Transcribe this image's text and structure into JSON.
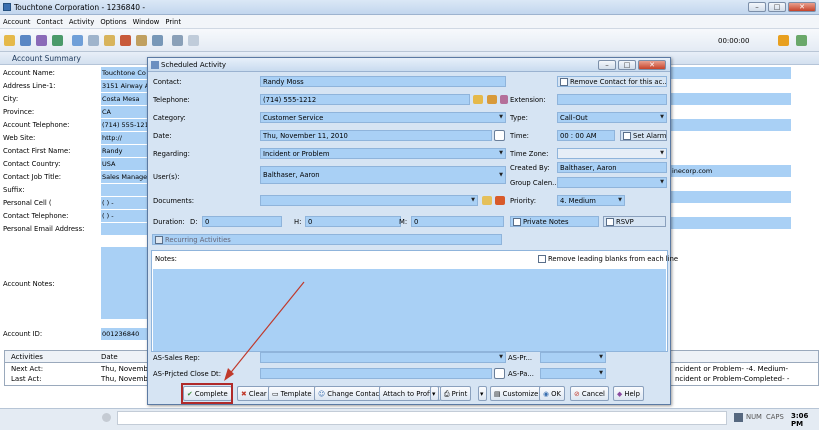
{
  "window": {
    "title": "Touchtone Corporation - 1236840 -"
  },
  "menu": [
    "Account",
    "Contact",
    "Activity",
    "Options",
    "Window",
    "Print"
  ],
  "toolbar": {
    "timer": "00:00:00"
  },
  "account_summary": {
    "title": "Account Summary",
    "rows": [
      {
        "label": "Account Name:",
        "value": "Touchtone Co"
      },
      {
        "label": "Address Line-1:",
        "value": "3151 Airway A"
      },
      {
        "label": "City:",
        "value": "Costa Mesa"
      },
      {
        "label": "Province:",
        "value": "CA"
      },
      {
        "label": "Account Telephone:",
        "value": "(714) 555-121"
      },
      {
        "label": "Web Site:",
        "value": "http://"
      },
      {
        "label": "Contact First Name:",
        "value": "Randy"
      },
      {
        "label": "Contact Country:",
        "value": "USA"
      },
      {
        "label": "Contact Job Title:",
        "value": "Sales Manage"
      },
      {
        "label": "Suffix:",
        "value": ""
      },
      {
        "label": "Personal Cell (",
        "value": "(   )   -"
      },
      {
        "label": "Contact Telephone:",
        "value": "(   )   -"
      },
      {
        "label": "Personal Email Address:",
        "value": ""
      }
    ],
    "notes_label": "Account Notes:",
    "id_label": "Account ID:",
    "id_value": "001236840",
    "right_email": "inecorp.com"
  },
  "grid": {
    "headers": [
      "Activities",
      "Date"
    ],
    "rows": [
      [
        "Next Act:",
        "Thu, November"
      ],
      [
        "Last Act:",
        "Thu, November"
      ]
    ],
    "right_rows": [
      "ncident or Problem- -4. Medium-",
      "ncident or Problem-Completed- -"
    ]
  },
  "dialog": {
    "title": "Scheduled Activity",
    "contact_label": "Contact:",
    "contact": "Randy Moss",
    "remove_contact": "Remove Contact for this ac...",
    "telephone_label": "Telephone:",
    "telephone": "(714) 555-1212",
    "extension_label": "Extension:",
    "category_label": "Category:",
    "category": "Customer Service",
    "type_label": "Type:",
    "type": "Call-Out",
    "date_label": "Date:",
    "date": "Thu, November 11, 2010",
    "time_label": "Time:",
    "time": "00 : 00   AM",
    "set_alarm": "Set Alarm",
    "regarding_label": "Regarding:",
    "regarding": "Incident or Problem",
    "timezone_label": "Time Zone:",
    "created_by_label": "Created By:",
    "created_by": "Balthaser, Aaron",
    "users_label": "User(s):",
    "users": "Balthaser, Aaron",
    "group_label": "Group Calen...",
    "documents_label": "Documents:",
    "priority_label": "Priority:",
    "priority": "4. Medium",
    "duration_label": "Duration:",
    "d_label": "D:",
    "d": "0",
    "h_label": "H:",
    "h": "0",
    "m_label": "M:",
    "m": "0",
    "private_notes": "Private Notes",
    "rsvp": "RSVP",
    "recurring": "Recurring Activities",
    "notes_label": "Notes:",
    "remove_blanks": "Remove leading blanks from each line",
    "sales_rep_label": "AS-Sales Rep:",
    "as_pr_label": "AS-Pr...",
    "close_dt_label": "AS-Prjcted Close Dt:",
    "as_pa_label": "AS-Pa...",
    "buttons": {
      "complete": "Complete",
      "clear": "Clear",
      "template": "Template",
      "change_contact": "Change Contact",
      "attach": "Attach to Profile",
      "print": "Print",
      "customize": "Customize",
      "ok": "OK",
      "cancel": "Cancel",
      "help": "Help"
    }
  },
  "status": {
    "num": "NUM",
    "caps": "CAPS",
    "time": "3:06 PM"
  },
  "colors": {
    "field_blue": "#a9d0f5",
    "arrow_red": "#c0392b"
  }
}
